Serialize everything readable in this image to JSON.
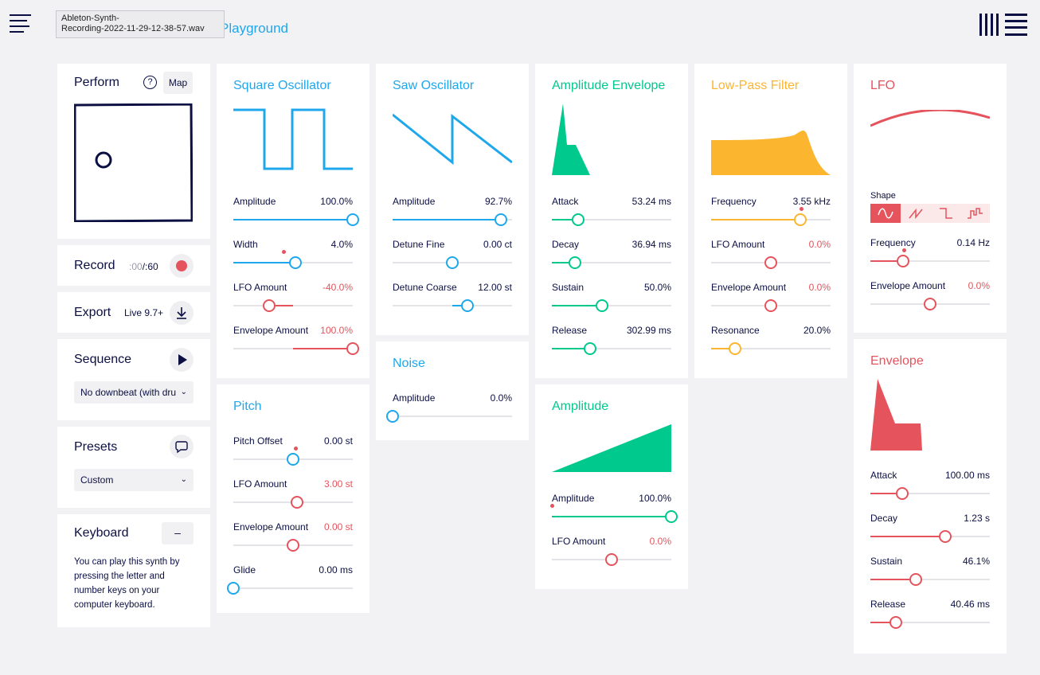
{
  "header": {
    "tooltip_line1": "Ableton-Synth-",
    "tooltip_line2": "Recording-2022-11-29-12-38-57.wav",
    "title_fragment": "Playground"
  },
  "sidebar": {
    "perform": {
      "title": "Perform",
      "help": "?",
      "map_label": "Map"
    },
    "record": {
      "title": "Record",
      "time_elapsed": ":00",
      "time_total": "/:60"
    },
    "export": {
      "title": "Export",
      "format": "Live 9.7+"
    },
    "sequence": {
      "title": "Sequence",
      "selected": "No downbeat (with dru"
    },
    "presets": {
      "title": "Presets",
      "selected": "Custom"
    },
    "keyboard": {
      "title": "Keyboard",
      "collapse": "–",
      "text": "You can play this synth by pressing the letter and number keys on your computer keyboard."
    }
  },
  "square": {
    "title": "Square Oscillator",
    "params": [
      {
        "label": "Amplitude",
        "value": "100.0%",
        "level": 1.0
      },
      {
        "label": "Width",
        "value": "4.0%",
        "level": 0.52
      },
      {
        "label": "LFO Amount",
        "value": "-40.0%",
        "level": 0.3
      },
      {
        "label": "Envelope Amount",
        "value": "100.0%",
        "level": 1.0
      }
    ]
  },
  "saw": {
    "title": "Saw Oscillator",
    "params": [
      {
        "label": "Amplitude",
        "value": "92.7%",
        "level": 0.907
      },
      {
        "label": "Detune Fine",
        "value": "0.00 ct",
        "level": 0.5
      },
      {
        "label": "Detune Coarse",
        "value": "12.00 st",
        "level": 0.627
      }
    ]
  },
  "noise": {
    "title": "Noise",
    "params": [
      {
        "label": "Amplitude",
        "value": "0.0%",
        "level": 0.0
      }
    ]
  },
  "pitch": {
    "title": "Pitch",
    "params": [
      {
        "label": "Pitch Offset",
        "value": "0.00 st",
        "level": 0.5
      },
      {
        "label": "LFO Amount",
        "value": "3.00 st",
        "level": 0.533
      },
      {
        "label": "Envelope Amount",
        "value": "0.00 st",
        "level": 0.5
      },
      {
        "label": "Glide",
        "value": "0.00 ms",
        "level": 0.0
      }
    ]
  },
  "ampenv": {
    "title": "Amplitude Envelope",
    "params": [
      {
        "label": "Attack",
        "value": "53.24 ms",
        "level": 0.22
      },
      {
        "label": "Decay",
        "value": "36.94 ms",
        "level": 0.193
      },
      {
        "label": "Sustain",
        "value": "50.0%",
        "level": 0.42
      },
      {
        "label": "Release",
        "value": "302.99 ms",
        "level": 0.32
      }
    ]
  },
  "amplitude": {
    "title": "Amplitude",
    "params": [
      {
        "label": "Amplitude",
        "value": "100.0%",
        "level": 1.0
      },
      {
        "label": "LFO Amount",
        "value": "0.0%",
        "level": 0.5
      }
    ]
  },
  "filter": {
    "title": "Low-Pass Filter",
    "params": [
      {
        "label": "Frequency",
        "value": "3.55 kHz",
        "level": 0.747
      },
      {
        "label": "LFO Amount",
        "value": "0.0%",
        "level": 0.5
      },
      {
        "label": "Envelope Amount",
        "value": "0.0%",
        "level": 0.5
      },
      {
        "label": "Resonance",
        "value": "20.0%",
        "level": 0.2
      }
    ]
  },
  "lfo": {
    "title": "LFO",
    "shape_label": "Shape",
    "params": [
      {
        "label": "Frequency",
        "value": "0.14 Hz",
        "level": 0.273
      },
      {
        "label": "Envelope Amount",
        "value": "0.0%",
        "level": 0.5
      }
    ]
  },
  "envelope": {
    "title": "Envelope",
    "params": [
      {
        "label": "Attack",
        "value": "100.00 ms",
        "level": 0.267
      },
      {
        "label": "Decay",
        "value": "1.23 s",
        "level": 0.627
      },
      {
        "label": "Sustain",
        "value": "46.1%",
        "level": 0.38
      },
      {
        "label": "Release",
        "value": "40.46 ms",
        "level": 0.213
      }
    ]
  },
  "colors": {
    "blue": "#1fa7ec",
    "green": "#00c98d",
    "orange": "#fcb52f",
    "red": "#e5535c",
    "navy": "#0b0f42"
  }
}
